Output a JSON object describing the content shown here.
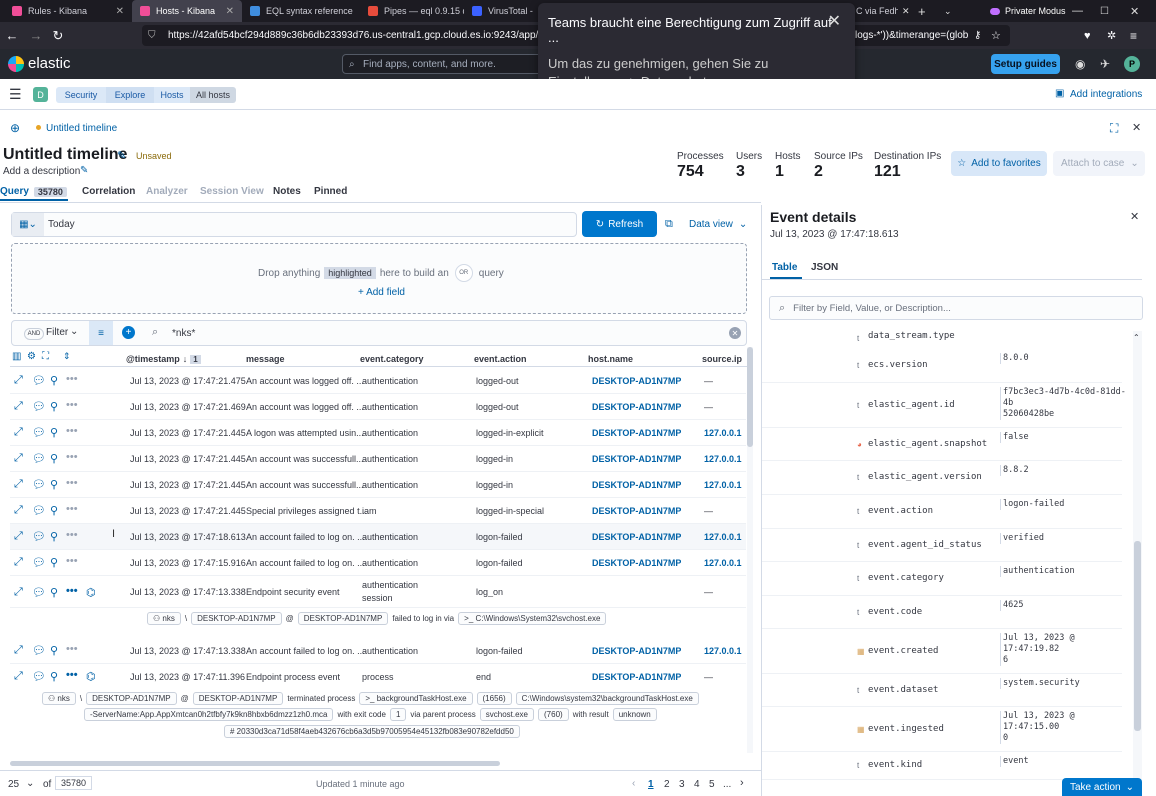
{
  "browser": {
    "tabs": [
      {
        "title": "Rules - Kibana",
        "color": "#f04e98"
      },
      {
        "title": "Hosts - Kibana",
        "color": "#f04e98"
      },
      {
        "title": "EQL syntax reference",
        "color": "#3f8dde"
      },
      {
        "title": "Pipes — eql 0.9.15 do",
        "color": "#e74c3c"
      },
      {
        "title": "VirusTotal - File",
        "color": "#3b61ff"
      },
      {
        "title": "C via Fedh",
        "color": "#555"
      }
    ],
    "private_label": "Privater Modus",
    "url": "https://42afd54bcf294d889c36b6db23393d76.us-central1.gcp.cloud.es.io:9243/app/securit",
    "url_tail": "logs-*'))&timerange=(glob"
  },
  "notification": {
    "title": "Teams braucht eine Berechtigung zum Zugriff auf ...",
    "body": "Um das zu genehmigen, gehen Sie zu Einstellungen > Datenschutz."
  },
  "kibana": {
    "brand": "elastic",
    "search_placeholder": "Find apps, content, and more.",
    "setup_guides": "Setup guides",
    "user_initial": "P",
    "space_initial": "D",
    "add_integrations": "Add integrations",
    "breadcrumbs": [
      "Security",
      "Explore",
      "Hosts",
      "All hosts"
    ]
  },
  "timeline": {
    "tab_title": "Untitled timeline",
    "title": "Untitled timeline",
    "unsaved": "Unsaved",
    "add_description": "Add a description",
    "stats": [
      {
        "label": "Processes",
        "value": "754"
      },
      {
        "label": "Users",
        "value": "3"
      },
      {
        "label": "Hosts",
        "value": "1"
      },
      {
        "label": "Source IPs",
        "value": "2"
      },
      {
        "label": "Destination IPs",
        "value": "121"
      }
    ],
    "add_to_favorites": "Add to favorites",
    "attach_to_case": "Attach to case",
    "tabs": {
      "query": "Query",
      "query_count": "35780",
      "correlation": "Correlation",
      "analyzer": "Analyzer",
      "session_view": "Session View",
      "notes": "Notes",
      "pinned": "Pinned"
    },
    "date": "Today",
    "refresh": "Refresh",
    "data_view": "Data view",
    "drop_text_1": "Drop anything",
    "drop_highlight": "highlighted",
    "drop_text_2": "here to build an",
    "drop_or": "OR",
    "drop_text_3": "query",
    "add_field": "+ Add field",
    "and_label": "AND",
    "filter_label": "Filter",
    "kql": "*nks*",
    "columns": {
      "timestamp": "@timestamp",
      "sort_count": "1",
      "message": "message",
      "category": "event.category",
      "action": "event.action",
      "host": "host.name",
      "source_ip": "source.ip"
    },
    "rows": [
      {
        "ts": "Jul 13, 2023 @ 17:47:21.475",
        "msg": "An account was logged off. ...",
        "cat": "authentication",
        "act": "logged-out",
        "host": "DESKTOP-AD1N7MP",
        "ip": "—"
      },
      {
        "ts": "Jul 13, 2023 @ 17:47:21.469",
        "msg": "An account was logged off. ...",
        "cat": "authentication",
        "act": "logged-out",
        "host": "DESKTOP-AD1N7MP",
        "ip": "—"
      },
      {
        "ts": "Jul 13, 2023 @ 17:47:21.445",
        "msg": "A logon was attempted usin...",
        "cat": "authentication",
        "act": "logged-in-explicit",
        "host": "DESKTOP-AD1N7MP",
        "ip": "127.0.0.1"
      },
      {
        "ts": "Jul 13, 2023 @ 17:47:21.445",
        "msg": "An account was successfull...",
        "cat": "authentication",
        "act": "logged-in",
        "host": "DESKTOP-AD1N7MP",
        "ip": "127.0.0.1"
      },
      {
        "ts": "Jul 13, 2023 @ 17:47:21.445",
        "msg": "An account was successfull...",
        "cat": "authentication",
        "act": "logged-in",
        "host": "DESKTOP-AD1N7MP",
        "ip": "127.0.0.1"
      },
      {
        "ts": "Jul 13, 2023 @ 17:47:21.445",
        "msg": "Special privileges assigned t...",
        "cat": "iam",
        "act": "logged-in-special",
        "host": "DESKTOP-AD1N7MP",
        "ip": "—"
      },
      {
        "ts": "Jul 13, 2023 @ 17:47:18.613",
        "msg": "An account failed to log on. ...",
        "cat": "authentication",
        "act": "logon-failed",
        "host": "DESKTOP-AD1N7MP",
        "ip": "127.0.0.1"
      },
      {
        "ts": "Jul 13, 2023 @ 17:47:15.916",
        "msg": "An account failed to log on. ...",
        "cat": "authentication",
        "act": "logon-failed",
        "host": "DESKTOP-AD1N7MP",
        "ip": "127.0.0.1"
      }
    ],
    "row9": {
      "ts": "Jul 13, 2023 @ 17:47:13.338",
      "msg": "Endpoint security event",
      "cat1": "authentication",
      "cat2": "session",
      "act": "log_on",
      "ip": "—"
    },
    "row9_detail": {
      "user": "nks",
      "sep": "\\",
      "host1": "DESKTOP-AD1N7MP",
      "at": "@",
      "host2": "DESKTOP-AD1N7MP",
      "text": "failed to log in via",
      "proc": ">_ C:\\Windows\\System32\\svchost.exe"
    },
    "row10": {
      "ts": "Jul 13, 2023 @ 17:47:13.338",
      "msg": "An account failed to log on. ...",
      "cat": "authentication",
      "act": "logon-failed",
      "host": "DESKTOP-AD1N7MP",
      "ip": "127.0.0.1"
    },
    "row11": {
      "ts": "Jul 13, 2023 @ 17:47:11.396",
      "msg": "Endpoint process event",
      "cat": "process",
      "act": "end",
      "host": "DESKTOP-AD1N7MP",
      "ip": "—"
    },
    "row11_detail": {
      "user": "nks",
      "sep": "\\",
      "host1": "DESKTOP-AD1N7MP",
      "at": "@",
      "host2": "DESKTOP-AD1N7MP",
      "terminated": "terminated process",
      "proc": ">_ backgroundTaskHost.exe",
      "pid": "(1656)",
      "path": "C:\\Windows\\system32\\backgroundTaskHost.exe",
      "args": "-ServerName:App.AppXmtcan0h2tfbfy7k9kn8hbxb6dmzz1zh0.mca",
      "exit_text": "with exit code",
      "exit_code": "1",
      "parent_text": "via parent process",
      "parent": "svchost.exe",
      "ppid": "(760)",
      "result_text": "with result",
      "result": "unknown",
      "hash": "# 20330d3ca71d58f4aeb432676cb6a3d5b97005954e45132fb083e90782efdd50"
    },
    "footer": {
      "rows_per_page": "25",
      "of": "of",
      "total": "35780",
      "updated": "Updated 1 minute ago",
      "pages": [
        "1",
        "2",
        "3",
        "4",
        "5"
      ],
      "ellipsis": "..."
    }
  },
  "event_details": {
    "title": "Event details",
    "timestamp": "Jul 13, 2023 @ 17:47:18.613",
    "tab_table": "Table",
    "tab_json": "JSON",
    "filter_placeholder": "Filter by Field, Value, or Description...",
    "partial_field": "data_stream.type",
    "fields": [
      {
        "icon": "t",
        "name": "ecs.version",
        "value": "8.0.0"
      },
      {
        "icon": "t",
        "name": "elastic_agent.id",
        "value": "f7bc3ec3-4d7b-4c0d-81dd-4b\n52060428be"
      },
      {
        "icon": "bool",
        "name": "elastic_agent.snapshot",
        "value": "false"
      },
      {
        "icon": "t",
        "name": "elastic_agent.version",
        "value": "8.8.2"
      },
      {
        "icon": "t",
        "name": "event.action",
        "value": "logon-failed"
      },
      {
        "icon": "t",
        "name": "event.agent_id_status",
        "value": "verified"
      },
      {
        "icon": "t",
        "name": "event.category",
        "value": "authentication"
      },
      {
        "icon": "t",
        "name": "event.code",
        "value": "4625"
      },
      {
        "icon": "date",
        "name": "event.created",
        "value": "Jul 13, 2023 @ 17:47:19.82\n6"
      },
      {
        "icon": "t",
        "name": "event.dataset",
        "value": "system.security"
      },
      {
        "icon": "date",
        "name": "event.ingested",
        "value": "Jul 13, 2023 @ 17:47:15.00\n0"
      },
      {
        "icon": "t",
        "name": "event.kind",
        "value": "event"
      }
    ],
    "take_action": "Take action"
  }
}
